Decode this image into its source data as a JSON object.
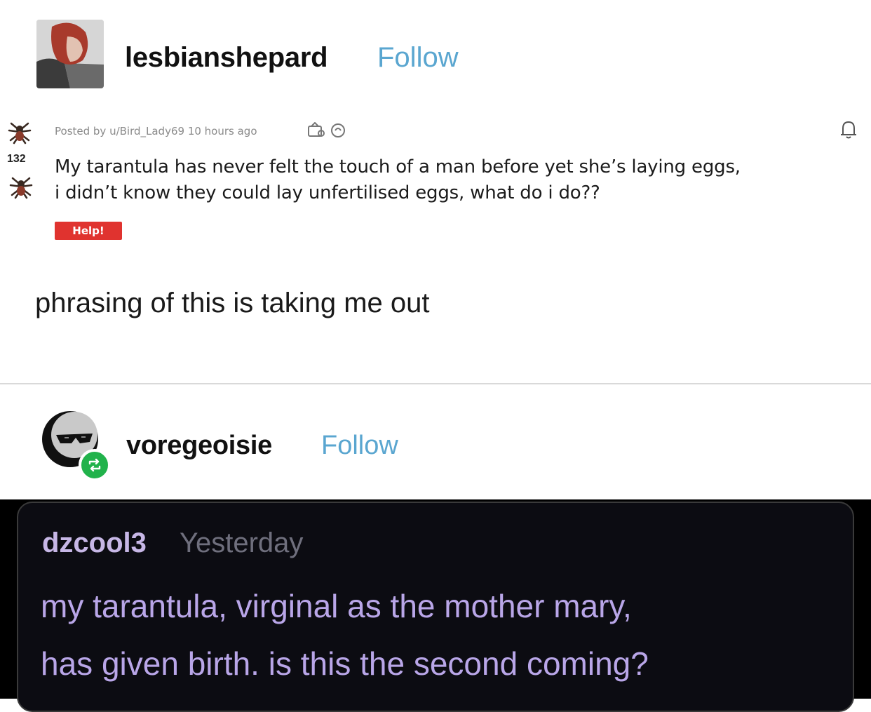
{
  "post": {
    "username": "lesbianshepard",
    "follow_label": "Follow"
  },
  "embedded": {
    "posted_by": "Posted by u/Bird_Lady69 10 hours ago",
    "vote_count": "132",
    "title_line1": "My tarantula has never felt the touch of a man before yet she’s laying eggs,",
    "title_line2": "i didn’t know they could lay unfertilised eggs, what do i do??",
    "flair": "Help!",
    "icons": [
      "upvote-spider-icon",
      "downvote-spider-icon",
      "award-icon",
      "award-icon-2",
      "bell-icon"
    ]
  },
  "comment": {
    "text": "phrasing of this is taking me out"
  },
  "reblogger": {
    "username": "voregeoisie",
    "follow_label": "Follow",
    "icons": [
      "reblog-icon"
    ]
  },
  "reply": {
    "username": "dzcool3",
    "time": "Yesterday",
    "line1": "my tarantula, virginal as the mother mary,",
    "line2": "has given birth. is this the second coming?"
  },
  "colors": {
    "follow": "#5aa6d0",
    "flair": "#e0332f",
    "reblog_badge": "#21b24b",
    "reply_user": "#c7b7e6",
    "reply_text": "#b9a6e8",
    "dark_bg": "#0c0c12"
  }
}
